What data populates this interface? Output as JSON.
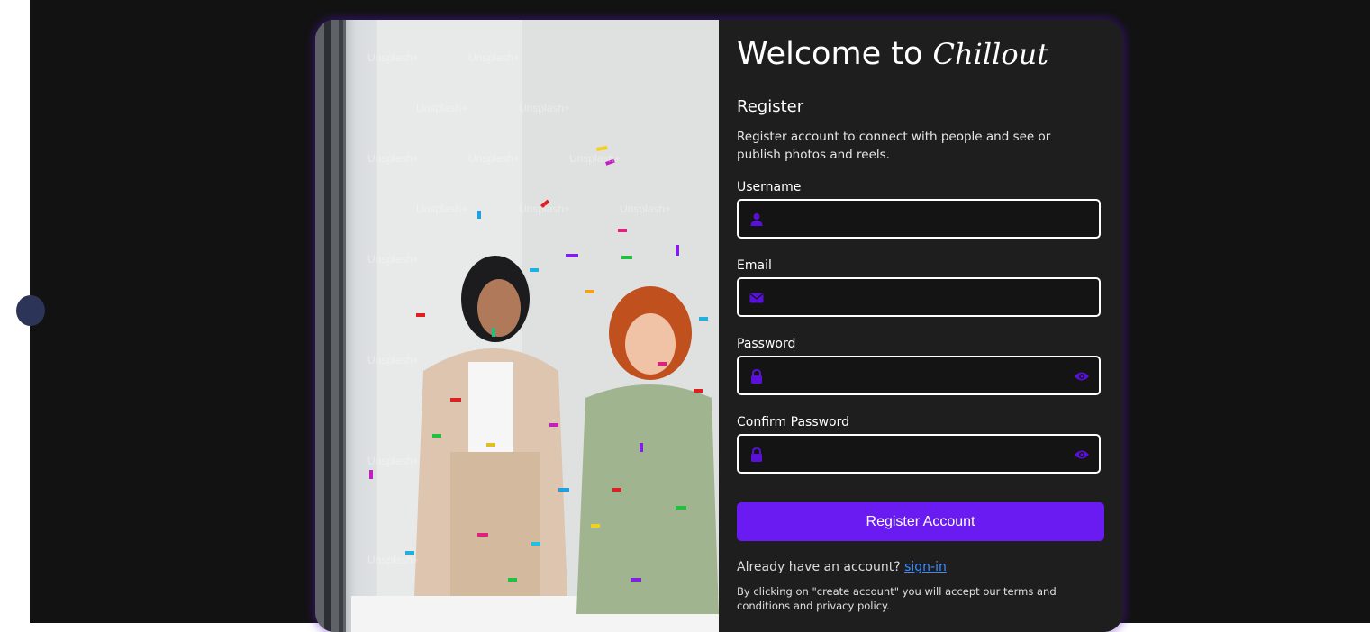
{
  "welcome": {
    "prefix": "Welcome to",
    "brand": "Chillout"
  },
  "register": {
    "title": "Register",
    "description": "Register account to connect with people and see or publish photos and reels."
  },
  "fields": {
    "username": {
      "label": "Username",
      "value": "",
      "icon": "user-icon"
    },
    "email": {
      "label": "Email",
      "value": "",
      "icon": "envelope-icon"
    },
    "password": {
      "label": "Password",
      "value": "",
      "icon": "lock-icon",
      "toggle_icon": "eye-icon"
    },
    "confirm_password": {
      "label": "Confirm Password",
      "value": "",
      "icon": "lock-icon",
      "toggle_icon": "eye-icon"
    }
  },
  "actions": {
    "submit_label": "Register Account",
    "signin_prompt": "Already have an account?",
    "signin_link": "sign-in"
  },
  "terms": "By clicking on \"create account\" you will accept our terms and conditions and privacy policy.",
  "photo": {
    "watermark": "Unsplash+"
  },
  "colors": {
    "accent": "#6a1bf2",
    "icon": "#5a10d8",
    "link": "#3d8cff",
    "page_bg": "#121212",
    "card_bg": "#1e1e1e"
  }
}
